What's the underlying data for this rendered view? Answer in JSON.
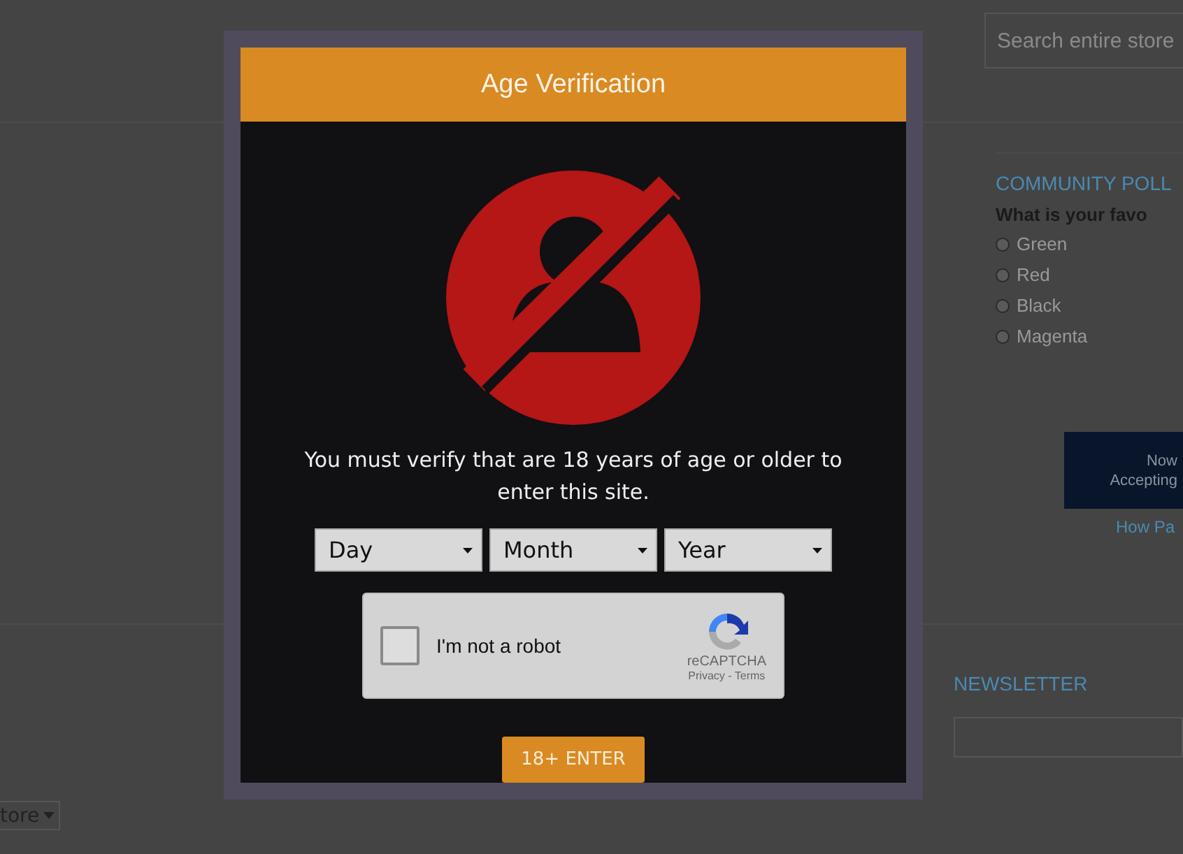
{
  "search": {
    "placeholder": "Search entire store"
  },
  "poll": {
    "title": "COMMUNITY POLL",
    "question": "What is your favo",
    "options": [
      {
        "label": "Green",
        "selected": false
      },
      {
        "label": "Red",
        "selected": false
      },
      {
        "label": "Black",
        "selected": false
      },
      {
        "label": "Magenta",
        "selected": false
      }
    ]
  },
  "promo": {
    "lines": [
      "Now",
      "Accepting"
    ],
    "link": "How Pa"
  },
  "newsletter": {
    "title": "NEWSLETTER"
  },
  "store_select": {
    "value": "tore"
  },
  "modal": {
    "title": "Age Verification",
    "message": "You must verify that are 18 years of age or older to enter this site.",
    "selects": [
      {
        "label": "Day"
      },
      {
        "label": "Month"
      },
      {
        "label": "Year"
      }
    ],
    "captcha": {
      "label": "I'm not a robot",
      "checked": false,
      "brand": "reCAPTCHA",
      "links": "Privacy - Terms"
    },
    "button": "18+ ENTER"
  }
}
